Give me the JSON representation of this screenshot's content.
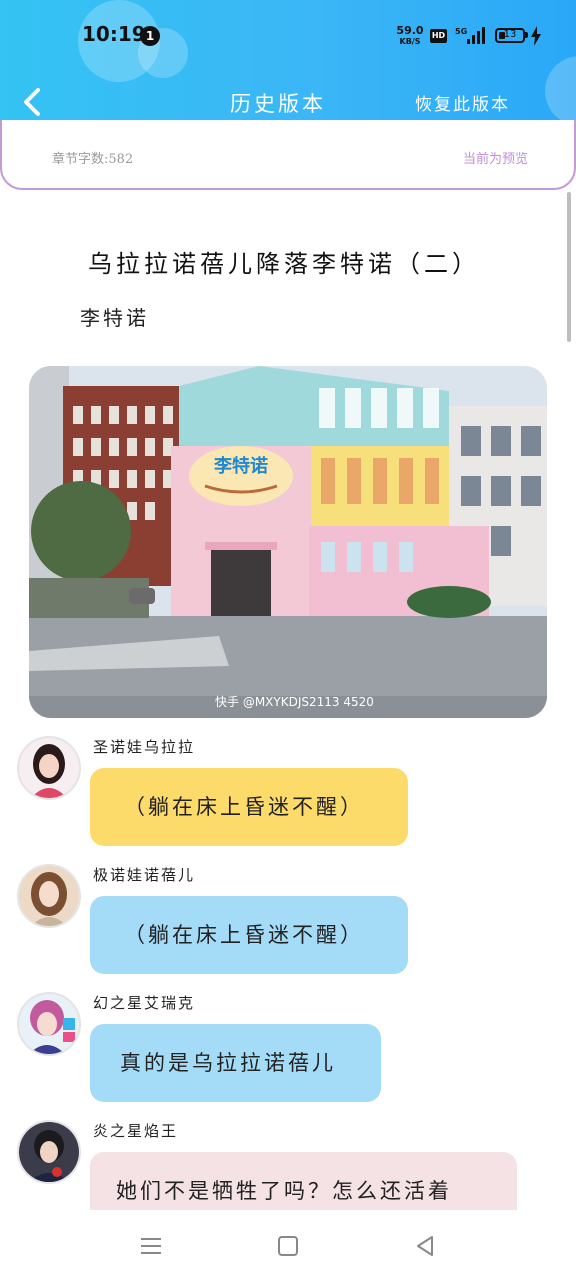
{
  "status_bar": {
    "time": "10:19",
    "notification_count": "1",
    "net_speed_value": "59.0",
    "net_speed_unit": "KB/S",
    "hd_label": "HD",
    "network_label": "5G",
    "battery_level": "13",
    "icons": [
      "hd-icon",
      "signal-icon",
      "battery-icon",
      "charging-icon"
    ]
  },
  "header": {
    "title": "历史版本",
    "action_label": "恢复此版本",
    "back_icon": "chevron-left-icon",
    "background_color": "#34c3f3"
  },
  "info": {
    "word_count": "章节字数:582",
    "preview_note": "当前为预览"
  },
  "chapter": {
    "title": "乌拉拉诺蓓儿降落李特诺（二）",
    "author": "李特诺",
    "image": {
      "shop_sign": "李特诺",
      "watermark": "快手 @MXYKDJS2113 4520"
    }
  },
  "messages": [
    {
      "speaker": "圣诺娃乌拉拉",
      "text": "（躺在床上昏迷不醒）",
      "bubble_color": "#fddb6b"
    },
    {
      "speaker": "极诺娃诺蓓儿",
      "text": "（躺在床上昏迷不醒）",
      "bubble_color": "#a4dcf8"
    },
    {
      "speaker": "幻之星艾瑞克",
      "text": "真的是乌拉拉诺蓓儿",
      "bubble_color": "#a4dcf8"
    },
    {
      "speaker": "炎之星焰王",
      "text": "她们不是牺牲了吗？怎么还活着",
      "bubble_color": "#f4e2e4"
    }
  ],
  "nav_bar": {
    "icons": [
      "menu-icon",
      "home-icon",
      "back-triangle-icon"
    ]
  }
}
